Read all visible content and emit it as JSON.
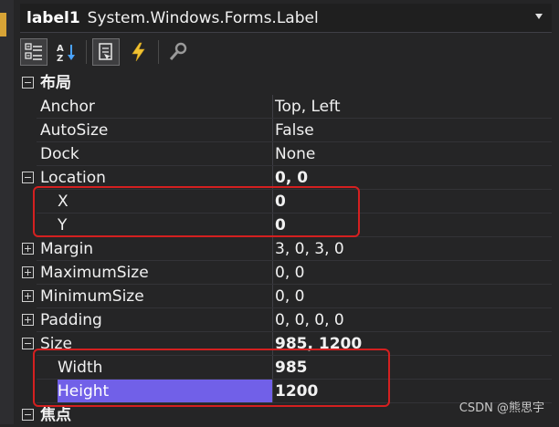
{
  "selector": {
    "object_name": "label1",
    "object_type": "System.Windows.Forms.Label"
  },
  "toolbar": {
    "buttons": [
      {
        "name": "categorized-icon",
        "active": true
      },
      {
        "name": "alphabetical-icon",
        "active": false
      },
      {
        "name": "properties-icon",
        "active": true
      },
      {
        "name": "events-lightning-icon",
        "active": false
      },
      {
        "name": "property-pages-wrench-icon",
        "active": false
      }
    ]
  },
  "grid": {
    "category_layout": "布局",
    "anchor": {
      "name": "Anchor",
      "value": "Top, Left"
    },
    "autosize": {
      "name": "AutoSize",
      "value": "False"
    },
    "dock": {
      "name": "Dock",
      "value": "None"
    },
    "location": {
      "name": "Location",
      "value": "0, 0"
    },
    "location_x": {
      "name": "X",
      "value": "0"
    },
    "location_y": {
      "name": "Y",
      "value": "0"
    },
    "margin": {
      "name": "Margin",
      "value": "3, 0, 3, 0"
    },
    "maximumsize": {
      "name": "MaximumSize",
      "value": "0, 0"
    },
    "minimumsize": {
      "name": "MinimumSize",
      "value": "0, 0"
    },
    "padding": {
      "name": "Padding",
      "value": "0, 0, 0, 0"
    },
    "size": {
      "name": "Size",
      "value": "985, 1200"
    },
    "size_width": {
      "name": "Width",
      "value": "985"
    },
    "size_height": {
      "name": "Height",
      "value": "1200"
    },
    "category_focus": "焦点"
  },
  "watermark": "CSDN @熊思宇",
  "colors": {
    "selection": "#7160e8",
    "highlight_box": "#d42020",
    "background": "#252526"
  }
}
